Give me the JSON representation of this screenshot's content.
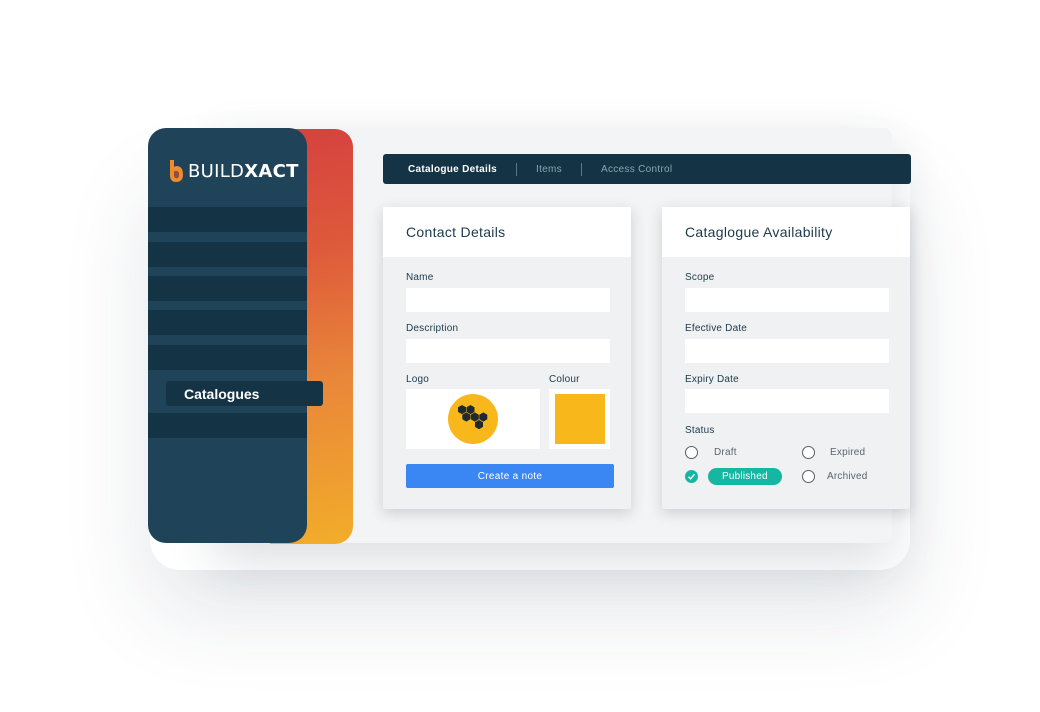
{
  "brand": {
    "logo_thin": "BUILD",
    "logo_bold": "XACT",
    "accent_orange": "#f08a2a",
    "sidebar_color": "#1f4358",
    "primary_blue": "#3a86f2",
    "success_teal": "#16b7a2"
  },
  "sidebar": {
    "active_item": "Catalogues"
  },
  "tabs": [
    {
      "label": "Catalogue Details",
      "active": true
    },
    {
      "label": "Items",
      "active": false
    },
    {
      "label": "Access Control",
      "active": false
    }
  ],
  "contact_card": {
    "title": "Contact Details",
    "name_label": "Name",
    "name_value": "",
    "description_label": "Description",
    "description_value": "",
    "logo_label": "Logo",
    "logo_icon": "hexagon-cluster-icon",
    "colour_label": "Colour",
    "colour_value": "#f8b81c",
    "button_label": "Create a note"
  },
  "availability_card": {
    "title": "Cataglogue Availability",
    "scope_label": "Scope",
    "scope_value": "",
    "effective_label": "Efective Date",
    "effective_value": "",
    "expiry_label": "Expiry Date",
    "expiry_value": "",
    "status_label": "Status",
    "statuses": [
      {
        "label": "Draft",
        "checked": false
      },
      {
        "label": "Expired",
        "checked": false
      },
      {
        "label": "Published",
        "checked": true
      },
      {
        "label": "Archived",
        "checked": false
      }
    ]
  }
}
